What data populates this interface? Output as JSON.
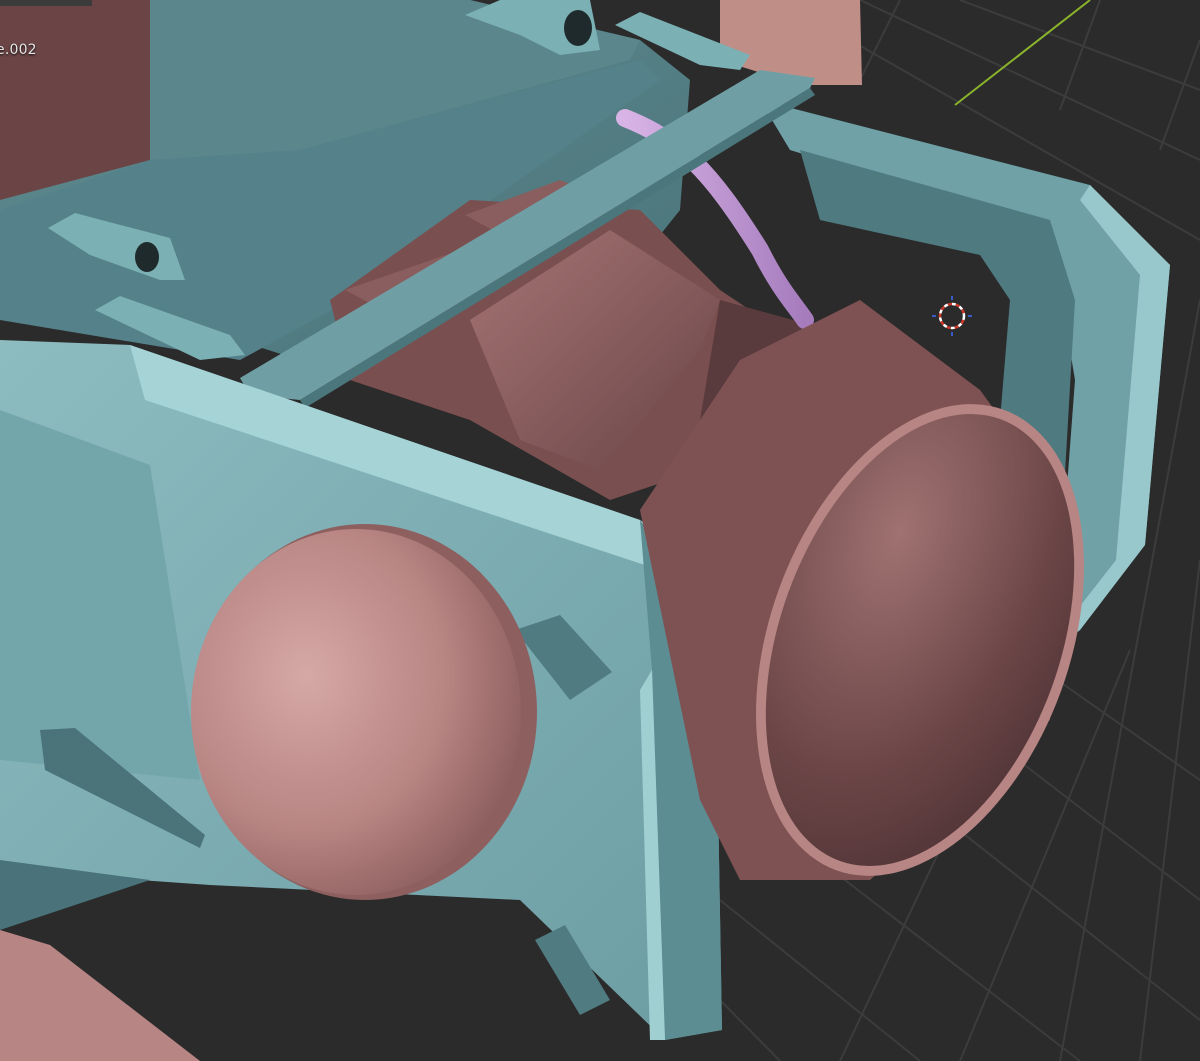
{
  "viewport": {
    "active_object_label": "e.002",
    "grid_color": "#3a3a3a",
    "background_color": "#2a2a2a",
    "y_axis_color": "#8ab42b"
  },
  "materials": {
    "teal_light": "#8fbcc0",
    "teal_mid": "#6fa2a7",
    "teal_dark": "#4d7a80",
    "teal_edge": "#a9d6d9",
    "rose_light": "#c99a98",
    "rose_mid": "#9c6c6b",
    "rose_dark": "#5a3b3d",
    "cable": "#c49ad8"
  },
  "gizmo": {
    "name": "3d-cursor"
  }
}
